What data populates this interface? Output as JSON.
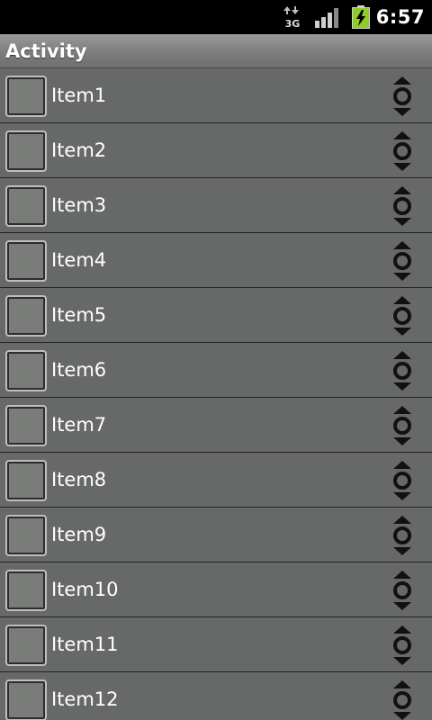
{
  "status_bar": {
    "network_label": "3G",
    "network_icon": "network-3g-icon",
    "signal_icon": "signal-strength-icon",
    "battery_icon": "battery-charging-icon",
    "time": "6:57"
  },
  "title_bar": {
    "title": "Activity"
  },
  "list": {
    "items": [
      {
        "label": "Item1",
        "checked": false
      },
      {
        "label": "Item2",
        "checked": false
      },
      {
        "label": "Item3",
        "checked": false
      },
      {
        "label": "Item4",
        "checked": false
      },
      {
        "label": "Item5",
        "checked": false
      },
      {
        "label": "Item6",
        "checked": false
      },
      {
        "label": "Item7",
        "checked": false
      },
      {
        "label": "Item8",
        "checked": false
      },
      {
        "label": "Item9",
        "checked": false
      },
      {
        "label": "Item10",
        "checked": false
      },
      {
        "label": "Item11",
        "checked": false
      },
      {
        "label": "Item12",
        "checked": false
      }
    ]
  },
  "colors": {
    "status_bar_bg": "#000000",
    "list_bg": "#676968",
    "divider": "#222222",
    "battery_accent": "#8ecb2b",
    "text": "#ffffff"
  }
}
